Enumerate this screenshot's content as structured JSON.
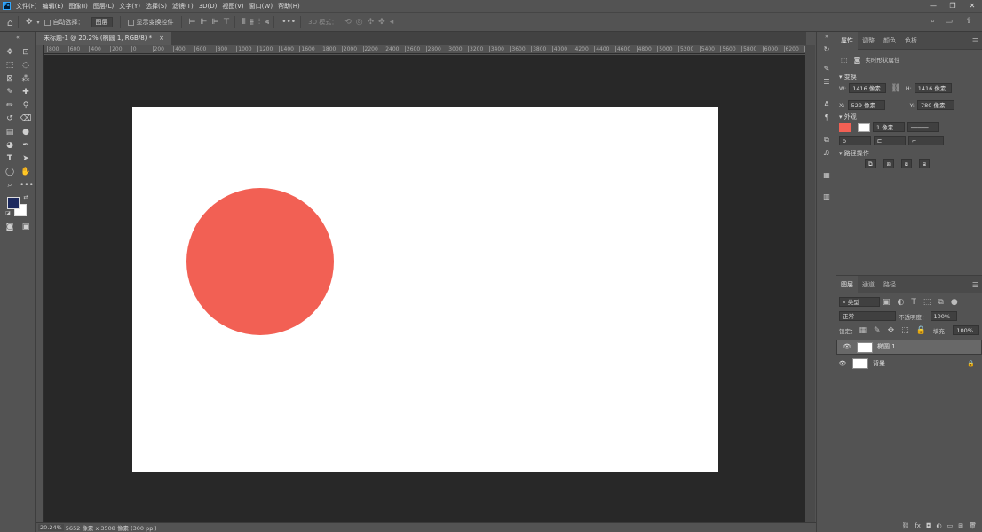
{
  "app": {
    "logo": "Ps"
  },
  "menu": [
    "文件(F)",
    "编辑(E)",
    "图像(I)",
    "图层(L)",
    "文字(Y)",
    "选择(S)",
    "滤镜(T)",
    "3D(D)",
    "视图(V)",
    "窗口(W)",
    "帮助(H)"
  ],
  "window_controls": {
    "minimize": "—",
    "maximize": "❐",
    "close": "✕"
  },
  "options": {
    "auto_select_label": "自动选择：",
    "auto_select_value": "图层",
    "show_transform_label": "显示变换控件",
    "more": "•••",
    "mode_3d_label": "3D 模式："
  },
  "document_tab": {
    "title": "未标题-1 @ 20.2% (椭圆 1, RGB/8) *",
    "close": "×"
  },
  "ruler_top": [
    "800",
    "600",
    "400",
    "200",
    "0",
    "200",
    "400",
    "600",
    "800",
    "1000",
    "1200",
    "1400",
    "1600",
    "1800",
    "2000",
    "2200",
    "2400",
    "2600",
    "2800",
    "3000",
    "3200",
    "3400",
    "3600",
    "3800",
    "4000",
    "4200",
    "4400",
    "4600",
    "4800",
    "5000",
    "5200",
    "5400",
    "5600",
    "5800",
    "6000",
    "6200",
    "640"
  ],
  "canvas": {
    "ellipse_color": "#f26054",
    "doc_color": "#ffffff"
  },
  "status": {
    "zoom": "20.24%",
    "info": "5652 像素 x 3508 像素 (300 ppi)"
  },
  "properties": {
    "tabs": [
      "属性",
      "调整",
      "颜色",
      "色板"
    ],
    "header": "实时形状属性",
    "transform_section": "变换",
    "w_label": "W:",
    "w_value": "1416 像素",
    "h_label": "H:",
    "h_value": "1416 像素",
    "x_label": "X:",
    "x_value": "529 像素",
    "y_label": "Y:",
    "y_value": "780 像素",
    "appearance_section": "外观",
    "stroke_width": "1 像素",
    "path_ops_section": "路径操作",
    "fill_color": "#f26054"
  },
  "layers": {
    "tabs": [
      "图层",
      "通道",
      "路径"
    ],
    "kind_label": "类型",
    "blend_mode": "正常",
    "opacity_label": "不透明度：",
    "opacity_value": "100%",
    "lock_label": "锁定：",
    "fill_label": "填充：",
    "fill_value": "100%",
    "items": [
      {
        "name": "椭圆 1",
        "selected": true
      },
      {
        "name": "背景",
        "selected": false
      }
    ],
    "footer": [
      "fx",
      "◘",
      "◐",
      "▭",
      "⊞",
      "🗑"
    ]
  }
}
